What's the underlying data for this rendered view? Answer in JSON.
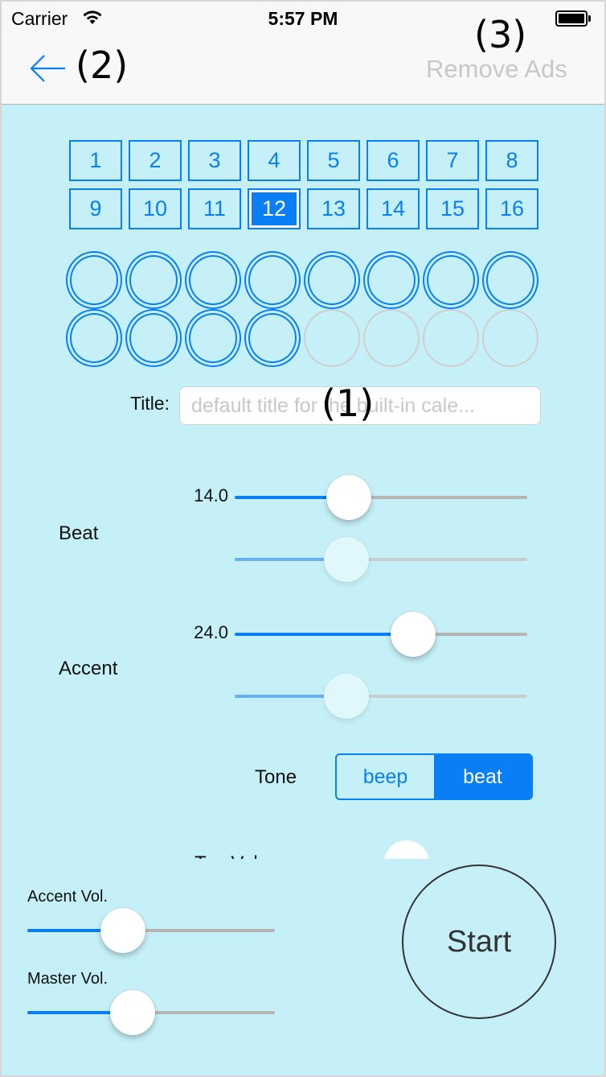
{
  "status_bar": {
    "carrier": "Carrier",
    "time": "5:57 PM",
    "wifi_icon": "wifi-icon",
    "battery_icon": "battery-full-icon"
  },
  "nav_bar": {
    "back_icon": "arrow-left-icon",
    "remove_ads_label": "Remove Ads",
    "annotation_back": "(2)",
    "annotation_remove_ads": "(3)"
  },
  "beat_selector": {
    "selected": 12,
    "accent_color": "#0a7ff5",
    "buttons": [
      "1",
      "2",
      "3",
      "4",
      "5",
      "6",
      "7",
      "8",
      "9",
      "10",
      "11",
      "12",
      "13",
      "14",
      "15",
      "16"
    ]
  },
  "beat_circles": {
    "total": 16,
    "active_count": 12,
    "active_color": "#0a7ff5",
    "inactive_color": "#cfcfcf"
  },
  "title_field": {
    "label": "Title:",
    "placeholder": "default title for the built-in cale...",
    "value": "",
    "annotation": "(1)"
  },
  "beat": {
    "label": "Beat",
    "value_label": "14.0",
    "slider_fraction": 0.37,
    "secondary_slider_fraction": 0.36,
    "secondary_enabled": false
  },
  "accent": {
    "label": "Accent",
    "value_label": "24.0",
    "slider_fraction": 0.63,
    "secondary_slider_fraction": 0.36,
    "secondary_enabled": false
  },
  "tone": {
    "label": "Tone",
    "options": [
      "beep",
      "beat"
    ],
    "selected": "beat"
  },
  "tap_vol": {
    "label": "Tap Vol."
  },
  "volumes": {
    "accent_vol_label": "Accent Vol.",
    "accent_vol_fraction": 0.36,
    "master_vol_label": "Master Vol.",
    "master_vol_fraction": 0.41
  },
  "start_button": {
    "label": "Start"
  },
  "colors": {
    "background": "#c5f0f7",
    "nav_background": "#f8f8f8",
    "tint": "#0a7ff5"
  }
}
